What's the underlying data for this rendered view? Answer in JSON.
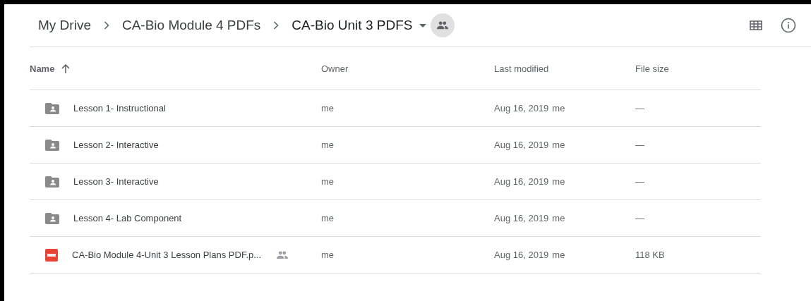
{
  "breadcrumb": [
    {
      "label": "My Drive",
      "current": false
    },
    {
      "label": "CA-Bio Module 4 PDFs",
      "current": false
    },
    {
      "label": "CA-Bio Unit 3 PDFS",
      "current": true
    }
  ],
  "folder_shared": true,
  "table": {
    "columns": [
      {
        "label": "Name",
        "sorted": true
      },
      {
        "label": "Owner",
        "sorted": false
      },
      {
        "label": "Last modified",
        "sorted": false
      },
      {
        "label": "File size",
        "sorted": false
      }
    ],
    "rows": [
      {
        "kind": "folder",
        "name": "Lesson 1- Instructional",
        "shared": false,
        "owner": "me",
        "modified": "Aug 16, 2019",
        "modified_by": "me",
        "size": "—"
      },
      {
        "kind": "folder",
        "name": "Lesson 2- Interactive",
        "shared": false,
        "owner": "me",
        "modified": "Aug 16, 2019",
        "modified_by": "me",
        "size": "—"
      },
      {
        "kind": "folder",
        "name": "Lesson 3- Interactive",
        "shared": false,
        "owner": "me",
        "modified": "Aug 16, 2019",
        "modified_by": "me",
        "size": "—"
      },
      {
        "kind": "folder",
        "name": "Lesson 4- Lab Component",
        "shared": false,
        "owner": "me",
        "modified": "Aug 16, 2019",
        "modified_by": "me",
        "size": "—"
      },
      {
        "kind": "pdf",
        "name": "CA-Bio Module 4-Unit 3 Lesson Plans PDF.p...",
        "shared": true,
        "owner": "me",
        "modified": "Aug 16, 2019",
        "modified_by": "me",
        "size": "118 KB"
      }
    ]
  }
}
